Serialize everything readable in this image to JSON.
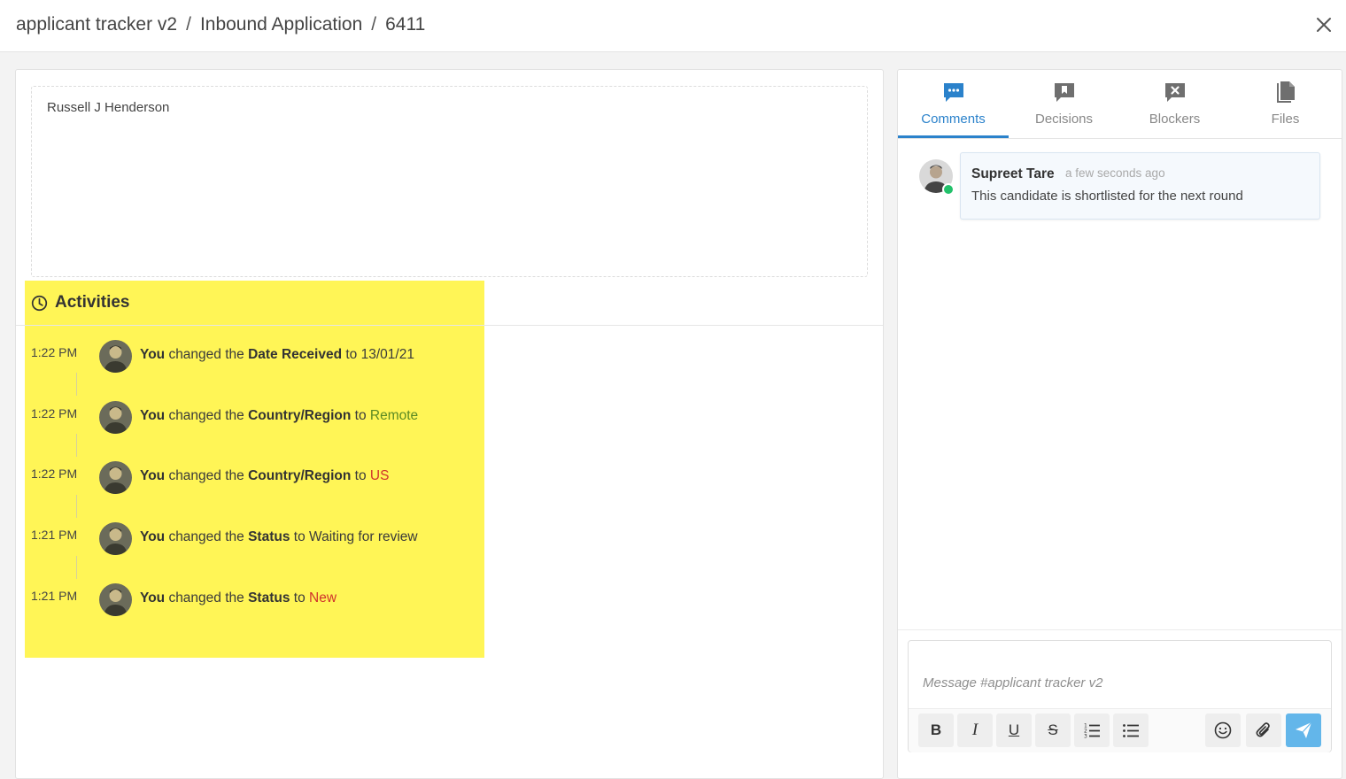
{
  "breadcrumb": {
    "items": [
      "applicant tracker v2",
      "Inbound Application",
      "6411"
    ],
    "separator": "/"
  },
  "close_icon": "close-icon",
  "notes": {
    "text": "Russell J Henderson"
  },
  "activities": {
    "title": "Activities",
    "icon": "clock-icon",
    "items": [
      {
        "time": "1:22 PM",
        "actor": "You",
        "verb": "changed the",
        "field": "Date Received",
        "to": "to",
        "value": "13/01/21",
        "value_color": "plain"
      },
      {
        "time": "1:22 PM",
        "actor": "You",
        "verb": "changed the",
        "field": "Country/Region",
        "to": "to",
        "value": "Remote",
        "value_color": "green"
      },
      {
        "time": "1:22 PM",
        "actor": "You",
        "verb": "changed the",
        "field": "Country/Region",
        "to": "to",
        "value": "US",
        "value_color": "red"
      },
      {
        "time": "1:21 PM",
        "actor": "You",
        "verb": "changed the",
        "field": "Status",
        "to": "to",
        "value": "Waiting for review",
        "value_color": "plain"
      },
      {
        "time": "1:21 PM",
        "actor": "You",
        "verb": "changed the",
        "field": "Status",
        "to": "to",
        "value": "New",
        "value_color": "red"
      }
    ]
  },
  "tabs": [
    {
      "label": "Comments",
      "icon": "comments-icon",
      "active": true
    },
    {
      "label": "Decisions",
      "icon": "decisions-icon",
      "active": false
    },
    {
      "label": "Blockers",
      "icon": "blockers-icon",
      "active": false
    },
    {
      "label": "Files",
      "icon": "files-icon",
      "active": false
    }
  ],
  "comment": {
    "author": "Supreet Tare",
    "time": "a few seconds ago",
    "text": "This candidate is shortlisted for the next round",
    "status": "online"
  },
  "composer": {
    "placeholder": "Message #applicant tracker v2",
    "toolbar": {
      "bold": "B",
      "italic": "I",
      "underline": "U",
      "strike": "S"
    }
  },
  "colors": {
    "accent": "#2b82cb",
    "highlight": "#fff556",
    "green": "#5b8a23",
    "red": "#d0342c",
    "send": "#63b6ea",
    "online": "#23c16b"
  }
}
